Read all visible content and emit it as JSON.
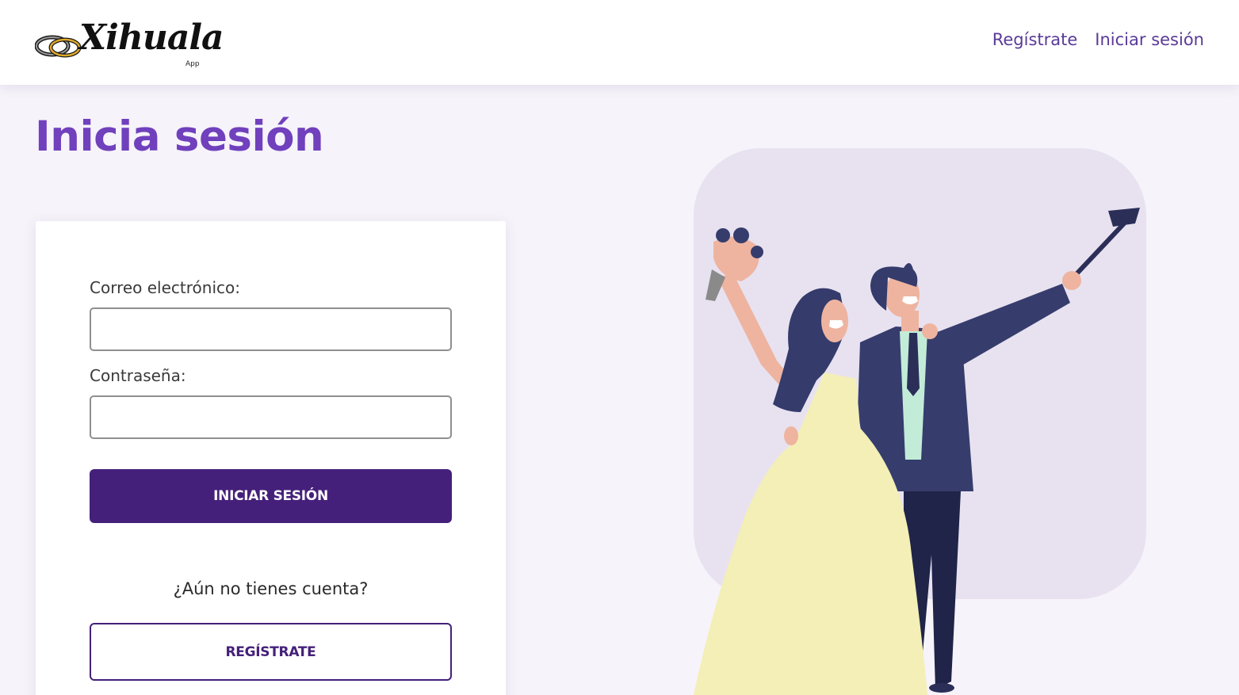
{
  "header": {
    "logo_text": "Xihuala",
    "logo_subtext": "App",
    "nav": [
      {
        "label": "Regístrate"
      },
      {
        "label": "Iniciar sesión"
      }
    ]
  },
  "main": {
    "title": "Inicia sesión",
    "form": {
      "email_label": "Correo electrónico:",
      "email_value": "",
      "password_label": "Contraseña:",
      "password_value": "",
      "submit_label": "INICIAR SESIÓN",
      "no_account_text": "¿Aún no tienes cuenta?",
      "register_label": "REGÍSTRATE"
    }
  },
  "colors": {
    "accent": "#7040bd",
    "primary_button": "#45207a",
    "nav_link": "#5a3a97",
    "page_bg": "#f6f3fa",
    "illustration_bg": "#e8e2f0",
    "dress": "#f3efb6",
    "suit": "#333a66",
    "skin": "#eeb4a0",
    "hair": "#353b6b",
    "shirt": "#c3ecd8"
  },
  "illustration": {
    "icon": "wedding-couple-selfie-illustration"
  }
}
